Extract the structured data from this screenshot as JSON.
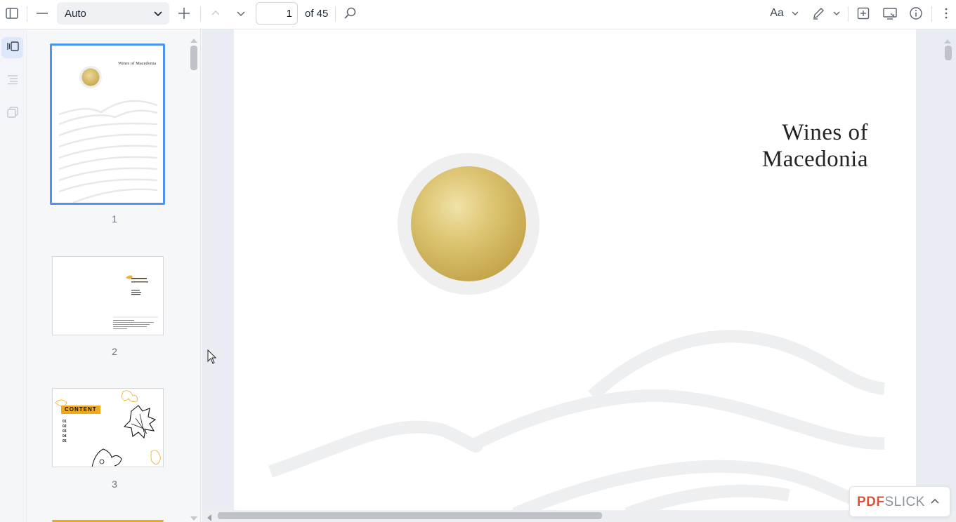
{
  "toolbar": {
    "zoom_value": "Auto",
    "page_current": "1",
    "page_total_label": "of 45",
    "text_menu_label": "Aa"
  },
  "sidebar": {
    "thumbnails": [
      {
        "label": "1",
        "title": "Wines of Macedonia"
      },
      {
        "label": "2"
      },
      {
        "label": "3",
        "heading": "CONTENT",
        "toc_numbers": [
          "01",
          "02",
          "03",
          "04",
          "05"
        ]
      }
    ]
  },
  "document": {
    "title_line1": "Wines of",
    "title_line2": "Macedonia"
  },
  "brand": {
    "name_part1": "PDF",
    "name_part2": "SLICK"
  },
  "colors": {
    "accent": "#4c94f0",
    "gold": "#d8bd62",
    "brand_red": "#e0533a",
    "content_orange": "#f0a818"
  }
}
